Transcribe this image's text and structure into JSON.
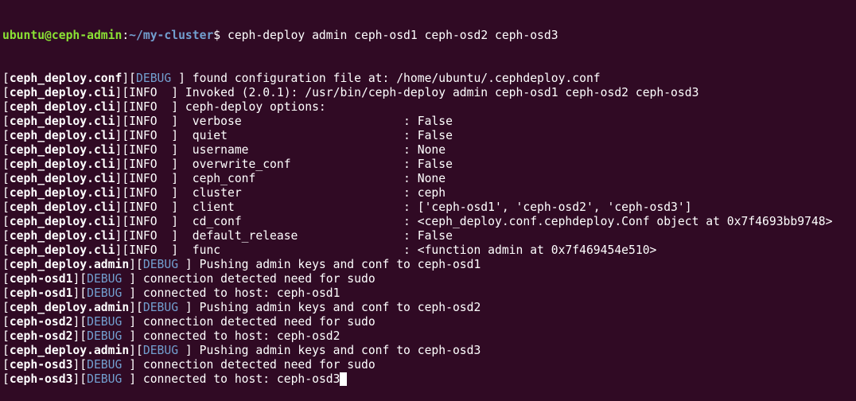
{
  "prompt": {
    "user_host": "ubuntu@ceph-admin",
    "colon": ":",
    "path": "~/my-cluster",
    "symbol": "$",
    "command": " ceph-deploy admin ceph-osd1 ceph-osd2 ceph-osd3"
  },
  "lines": [
    {
      "src": "ceph_deploy.conf",
      "lvl": "DEBUG ",
      "msg": " found configuration file at: /home/ubuntu/.cephdeploy.conf"
    },
    {
      "src": "ceph_deploy.cli",
      "lvl": "INFO  ",
      "msg": " Invoked (2.0.1): /usr/bin/ceph-deploy admin ceph-osd1 ceph-osd2 ceph-osd3"
    },
    {
      "src": "ceph_deploy.cli",
      "lvl": "INFO  ",
      "msg": " ceph-deploy options:"
    },
    {
      "src": "ceph_deploy.cli",
      "lvl": "INFO  ",
      "msg": "  verbose                       : False"
    },
    {
      "src": "ceph_deploy.cli",
      "lvl": "INFO  ",
      "msg": "  quiet                         : False"
    },
    {
      "src": "ceph_deploy.cli",
      "lvl": "INFO  ",
      "msg": "  username                      : None"
    },
    {
      "src": "ceph_deploy.cli",
      "lvl": "INFO  ",
      "msg": "  overwrite_conf                : False"
    },
    {
      "src": "ceph_deploy.cli",
      "lvl": "INFO  ",
      "msg": "  ceph_conf                     : None"
    },
    {
      "src": "ceph_deploy.cli",
      "lvl": "INFO  ",
      "msg": "  cluster                       : ceph"
    },
    {
      "src": "ceph_deploy.cli",
      "lvl": "INFO  ",
      "msg": "  client                        : ['ceph-osd1', 'ceph-osd2', 'ceph-osd3']"
    },
    {
      "src": "ceph_deploy.cli",
      "lvl": "INFO  ",
      "msg": "  cd_conf                       : <ceph_deploy.conf.cephdeploy.Conf object at 0x7f4693bb9748>"
    },
    {
      "src": "ceph_deploy.cli",
      "lvl": "INFO  ",
      "msg": "  default_release               : False"
    },
    {
      "src": "ceph_deploy.cli",
      "lvl": "INFO  ",
      "msg": "  func                          : <function admin at 0x7f469454e510>"
    },
    {
      "src": "ceph_deploy.admin",
      "lvl": "DEBUG ",
      "msg": " Pushing admin keys and conf to ceph-osd1"
    },
    {
      "src": "ceph-osd1",
      "lvl": "DEBUG ",
      "msg": " connection detected need for sudo"
    },
    {
      "src": "ceph-osd1",
      "lvl": "DEBUG ",
      "msg": " connected to host: ceph-osd1"
    },
    {
      "src": "ceph_deploy.admin",
      "lvl": "DEBUG ",
      "msg": " Pushing admin keys and conf to ceph-osd2"
    },
    {
      "src": "ceph-osd2",
      "lvl": "DEBUG ",
      "msg": " connection detected need for sudo"
    },
    {
      "src": "ceph-osd2",
      "lvl": "DEBUG ",
      "msg": " connected to host: ceph-osd2"
    },
    {
      "src": "ceph_deploy.admin",
      "lvl": "DEBUG ",
      "msg": " Pushing admin keys and conf to ceph-osd3"
    },
    {
      "src": "ceph-osd3",
      "lvl": "DEBUG ",
      "msg": " connection detected need for sudo"
    },
    {
      "src": "ceph-osd3",
      "lvl": "DEBUG ",
      "msg": " connected to host: ceph-osd3"
    }
  ],
  "colors": {
    "background": "#300a24",
    "text": "#ffffff",
    "prompt_user": "#8ae234",
    "prompt_path": "#729fcf",
    "debug": "#729fcf"
  }
}
